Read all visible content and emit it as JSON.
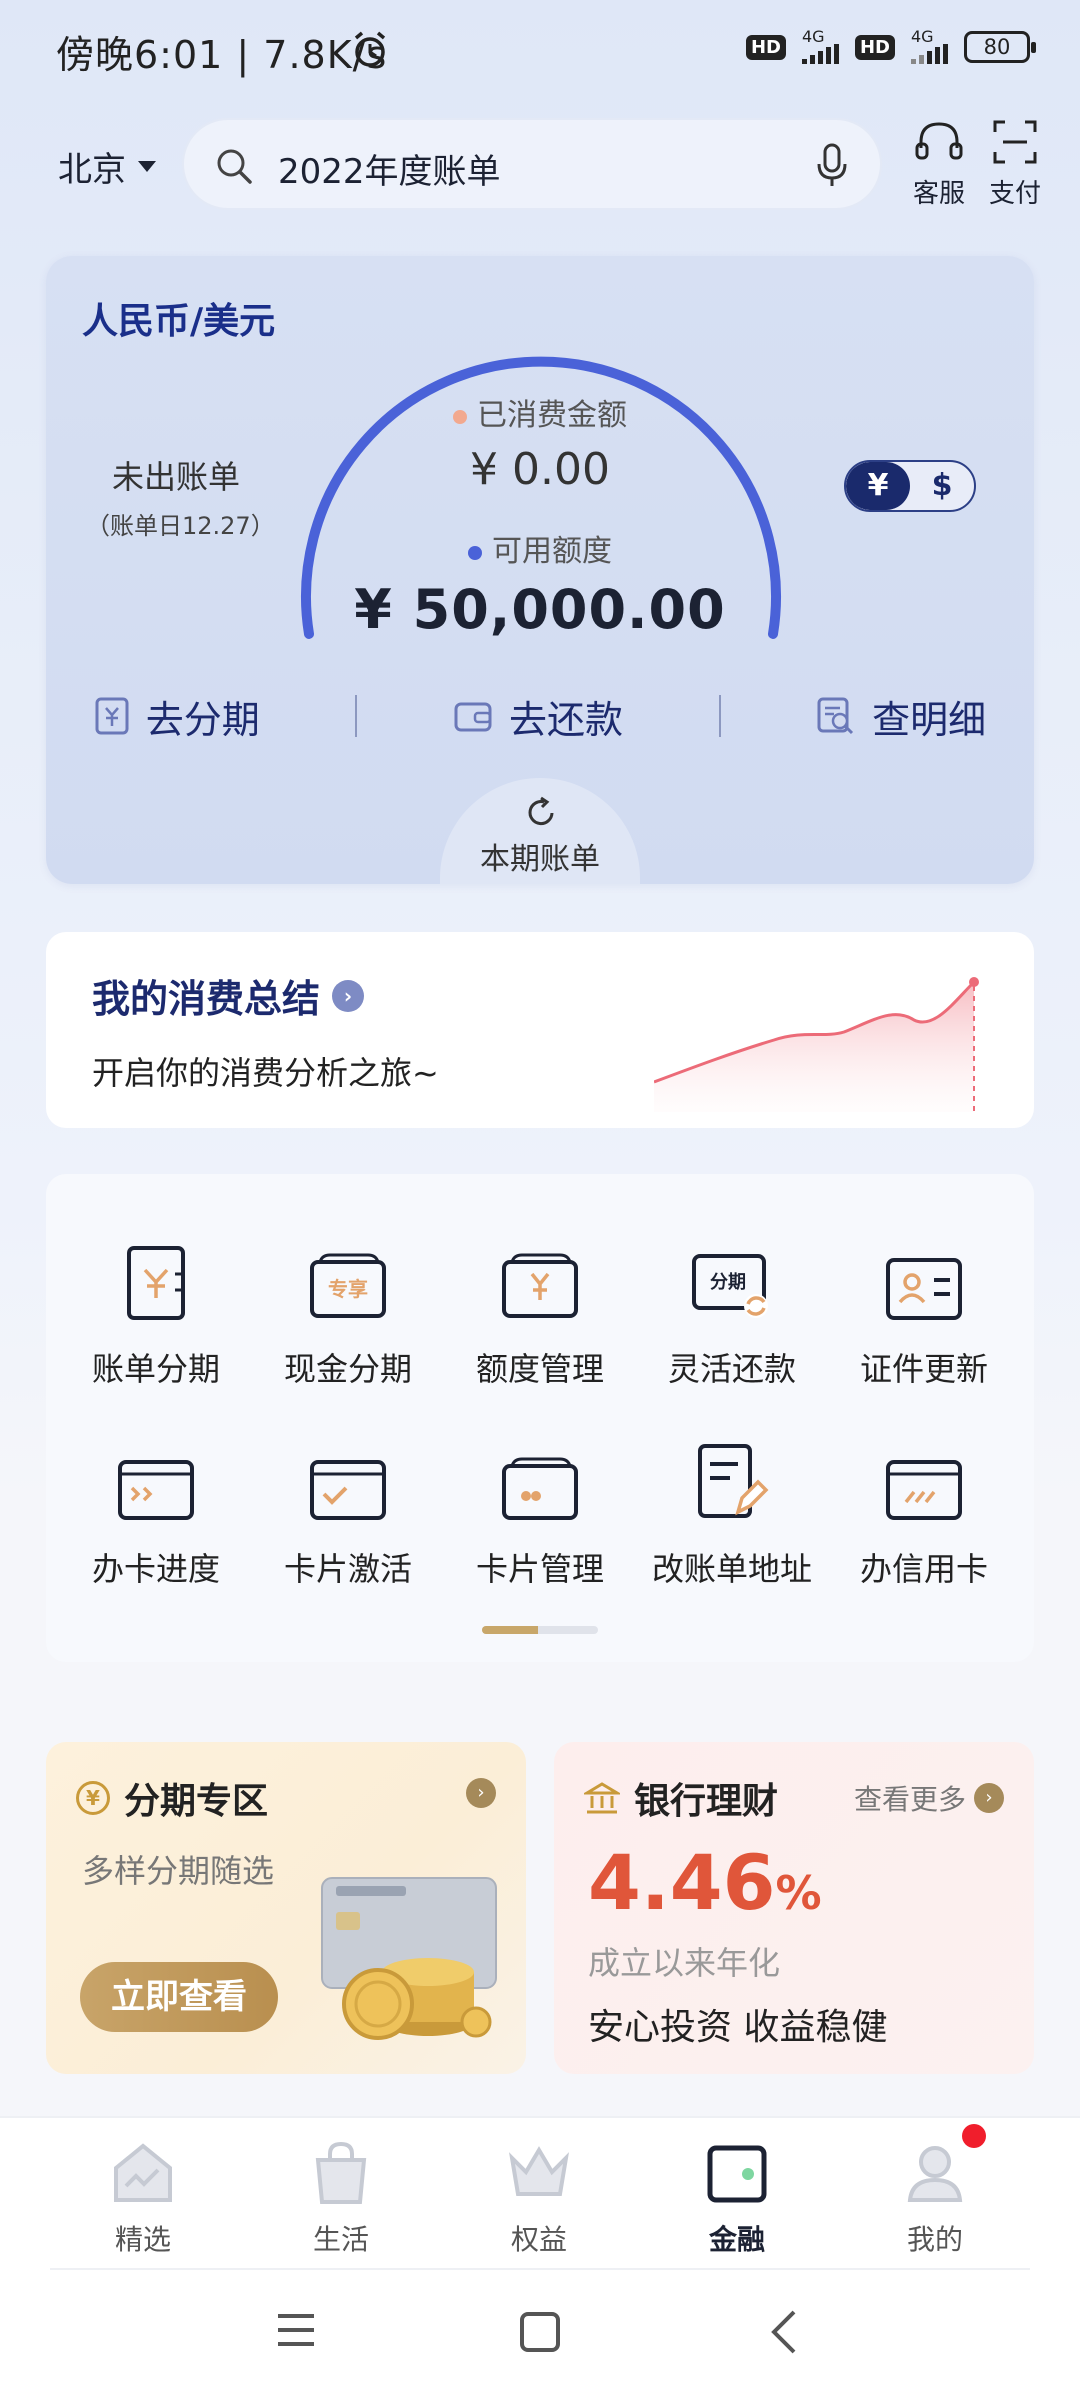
{
  "status_bar": {
    "time": "傍晚6:01 | 7.8K/s",
    "hd1": "HD",
    "net1": "4G",
    "hd2": "HD",
    "net2": "4G",
    "battery": "80"
  },
  "header": {
    "city": "北京",
    "search_text": "2022年度账单",
    "service_label": "客服",
    "pay_label": "支付"
  },
  "bill_card": {
    "currency": "人民币/美元",
    "unbilled_label": "未出账单",
    "bill_day": "（账单日12.27）",
    "spent_label": "已消费金额",
    "spent_value": "¥ 0.00",
    "available_label": "可用额度",
    "available_value": "¥ 50,000.00",
    "toggle_cny": "¥",
    "toggle_usd": "$",
    "action_installment": "去分期",
    "action_repay": "去还款",
    "action_details": "查明细",
    "current_bill": "本期账单",
    "spent_dot_color": "#f2a98f",
    "available_dot_color": "#4a62d8"
  },
  "summary": {
    "title": "我的消费总结",
    "subtitle": "开启你的消费分析之旅~"
  },
  "grid": {
    "row1": [
      {
        "label": "账单分期",
        "icon": "bill-installment-icon"
      },
      {
        "label": "现金分期",
        "icon": "cash-installment-icon"
      },
      {
        "label": "额度管理",
        "icon": "limit-management-icon"
      },
      {
        "label": "灵活还款",
        "icon": "flexible-repay-icon"
      },
      {
        "label": "证件更新",
        "icon": "id-update-icon"
      }
    ],
    "row2": [
      {
        "label": "办卡进度",
        "icon": "card-progress-icon"
      },
      {
        "label": "卡片激活",
        "icon": "card-activate-icon"
      },
      {
        "label": "卡片管理",
        "icon": "card-manage-icon"
      },
      {
        "label": "改账单地址",
        "icon": "address-edit-icon"
      },
      {
        "label": "办信用卡",
        "icon": "apply-card-icon"
      }
    ],
    "icon_badges": {
      "exclusive": "专享",
      "installment": "分期"
    }
  },
  "promo_installment": {
    "title": "分期专区",
    "subtitle": "多样分期随选",
    "button": "立即查看"
  },
  "promo_wealth": {
    "title": "银行理财",
    "more": "查看更多",
    "rate": "4.46",
    "rate_unit": "%",
    "rate_label": "成立以来年化",
    "slogan": "安心投资 收益稳健"
  },
  "bottom_nav": [
    {
      "label": "精选",
      "active": false
    },
    {
      "label": "生活",
      "active": false
    },
    {
      "label": "权益",
      "active": false
    },
    {
      "label": "金融",
      "active": true
    },
    {
      "label": "我的",
      "active": false
    }
  ],
  "colors": {
    "brand_navy": "#1a2a6c",
    "gauge_blue": "#4a62d8",
    "gold": "#c8a469",
    "rate_red": "#e0563a"
  }
}
